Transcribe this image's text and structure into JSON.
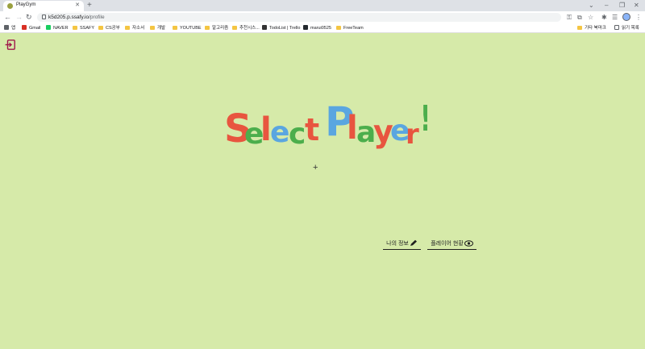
{
  "browser": {
    "tab_title": "PlayGym",
    "tab_close": "✕",
    "new_tab": "+",
    "url_host": "k5d205.p.ssafy.io",
    "url_path": "/profile",
    "bookmarks": [
      {
        "label": "앱",
        "kind": "apps"
      },
      {
        "label": "Gmail",
        "kind": "gmail"
      },
      {
        "label": "NAVER",
        "kind": "naver"
      },
      {
        "label": "SSAFY",
        "kind": "folder"
      },
      {
        "label": "CS공부",
        "kind": "folder"
      },
      {
        "label": "자소서",
        "kind": "folder"
      },
      {
        "label": "개발",
        "kind": "folder"
      },
      {
        "label": "YOUTUBE",
        "kind": "folder"
      },
      {
        "label": "알고리즘",
        "kind": "folder"
      },
      {
        "label": "추천시스...",
        "kind": "folder"
      },
      {
        "label": "TodoList | Trello",
        "kind": "trello"
      },
      {
        "label": "marui0525",
        "kind": "github"
      },
      {
        "label": "FreeTeam",
        "kind": "folder"
      }
    ],
    "other_bookmarks": "기타 북마크",
    "reading_list": "읽기 목록"
  },
  "page": {
    "headline_words": [
      "Select",
      "Player!"
    ],
    "headline_letters": [
      {
        "ch": "S",
        "color": "#e8553f"
      },
      {
        "ch": "e",
        "color": "#4cae4c"
      },
      {
        "ch": "l",
        "color": "#e8553f"
      },
      {
        "ch": "e",
        "color": "#5aa6e0"
      },
      {
        "ch": "c",
        "color": "#4cae4c"
      },
      {
        "ch": "t",
        "color": "#e8553f"
      },
      {
        "ch": "P",
        "color": "#5aa6e0"
      },
      {
        "ch": "l",
        "color": "#e8553f"
      },
      {
        "ch": "a",
        "color": "#4cae4c"
      },
      {
        "ch": "y",
        "color": "#e8553f"
      },
      {
        "ch": "e",
        "color": "#5aa6e0"
      },
      {
        "ch": "r",
        "color": "#e8553f"
      },
      {
        "ch": "!",
        "color": "#4cae4c"
      }
    ],
    "add_symbol": "+",
    "my_info_label": "나의 정보",
    "player_status_label": "플레이어 현황"
  },
  "colors": {
    "page_background": "#d6eaa9",
    "exit_icon": "#a0174a"
  }
}
